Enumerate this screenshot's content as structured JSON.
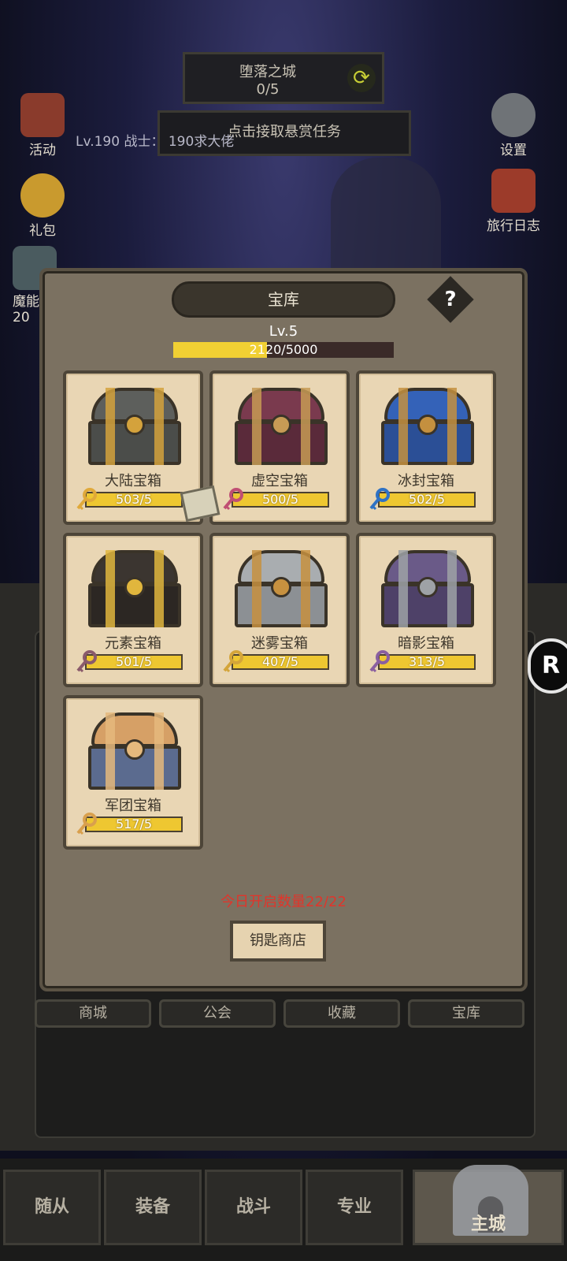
{
  "hud": {
    "stage_name": "堕落之城",
    "stage_progress": "0/5",
    "bounty_text": "点击接取悬赏任务",
    "player_info": "Lv.190 战士： 190求大佬"
  },
  "side_left": [
    {
      "label": "活动"
    },
    {
      "label": "礼包"
    },
    {
      "label": "魔能"
    },
    {
      "label": "20"
    }
  ],
  "side_right": [
    {
      "label": "设置"
    },
    {
      "label": "旅行日志"
    }
  ],
  "vault": {
    "title": "宝库",
    "help": "?",
    "level": "Lv.5",
    "xp_text": "2120/5000",
    "xp_fraction": 0.424,
    "today_count": "今日开启数量22/22",
    "shop_button": "钥匙商店"
  },
  "chests": [
    {
      "name": "大陆宝箱",
      "count": "503/5",
      "lid": "#5d5f5c",
      "body": "#4b4d4a",
      "band": "#d4a23c",
      "key": "#e0a93a"
    },
    {
      "name": "虚空宝箱",
      "count": "500/5",
      "lid": "#7a3a4e",
      "body": "#5a2a3a",
      "band": "#c79b55",
      "key": "#c04f73"
    },
    {
      "name": "冰封宝箱",
      "count": "502/5",
      "lid": "#3462b8",
      "body": "#2b4f96",
      "band": "#c4903f",
      "key": "#2f72c4"
    },
    {
      "name": "元素宝箱",
      "count": "501/5",
      "lid": "#3b3530",
      "body": "#2c2723",
      "band": "#e1b63d",
      "key": "#8a5a6b"
    },
    {
      "name": "迷雾宝箱",
      "count": "407/5",
      "lid": "#a9adb0",
      "body": "#8c9094",
      "band": "#c7913f",
      "key": "#d4a53a"
    },
    {
      "name": "暗影宝箱",
      "count": "313/5",
      "lid": "#6a5a88",
      "body": "#4e4168",
      "band": "#9ea2a6",
      "key": "#8a5fa0"
    },
    {
      "name": "军团宝箱",
      "count": "517/5",
      "lid": "#d6a066",
      "body": "#5b6b8f",
      "band": "#e5b97d",
      "key": "#d9a04d"
    }
  ],
  "buildings": [
    "商城",
    "公会",
    "收藏",
    "宝库"
  ],
  "bottom_nav": [
    {
      "label": "随从"
    },
    {
      "label": "装备"
    },
    {
      "label": "战斗"
    },
    {
      "label": "专业"
    },
    {
      "label": "主城"
    }
  ]
}
